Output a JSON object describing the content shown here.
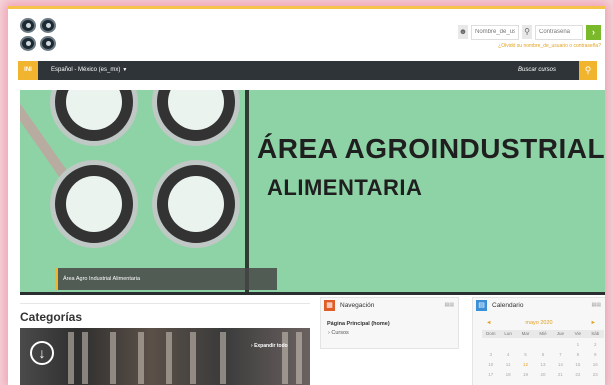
{
  "header": {
    "username_placeholder": "Nombre_de_usua",
    "password_placeholder": "Contraseña",
    "login_go": "›",
    "forgot_link": "¿Olvidó su nombre_de_usuario o contraseña?",
    "user_icon": "person-icon",
    "key_icon": "key-icon"
  },
  "navbar": {
    "home": "INI",
    "language": "Español - México (es_mx)",
    "search_placeholder": "Buscar cursos",
    "search_icon": "magnifier-icon"
  },
  "banner": {
    "title": "ÁREA AGROINDUSTRIAL",
    "subtitle": "ALIMENTARIA",
    "caption": "Área Agro Industrial Alimentaria"
  },
  "categories": {
    "title": "Categorías",
    "expand_all": "Expandir todo"
  },
  "navigation_block": {
    "title": "Navegación",
    "home_link": "Página Principal (home)",
    "courses": "Cursos"
  },
  "calendar_block": {
    "title": "Calendario",
    "month": "mayo 2020",
    "prev": "◄",
    "next": "►",
    "weekdays": [
      "Dom",
      "Lun",
      "Mar",
      "Mié",
      "Jue",
      "Vie",
      "Sáb"
    ],
    "days": [
      "",
      "",
      "",
      "",
      "",
      "1",
      "2",
      "3",
      "4",
      "5",
      "6",
      "7",
      "8",
      "9",
      "10",
      "11",
      "12",
      "13",
      "14",
      "15",
      "16",
      "17",
      "18",
      "19",
      "20",
      "21",
      "22",
      "23"
    ],
    "today": "12"
  },
  "colors": {
    "accent": "#f1b42f",
    "navbar": "#2e3437",
    "banner_bg": "#8ed3a6",
    "login_button": "#7ab929"
  }
}
